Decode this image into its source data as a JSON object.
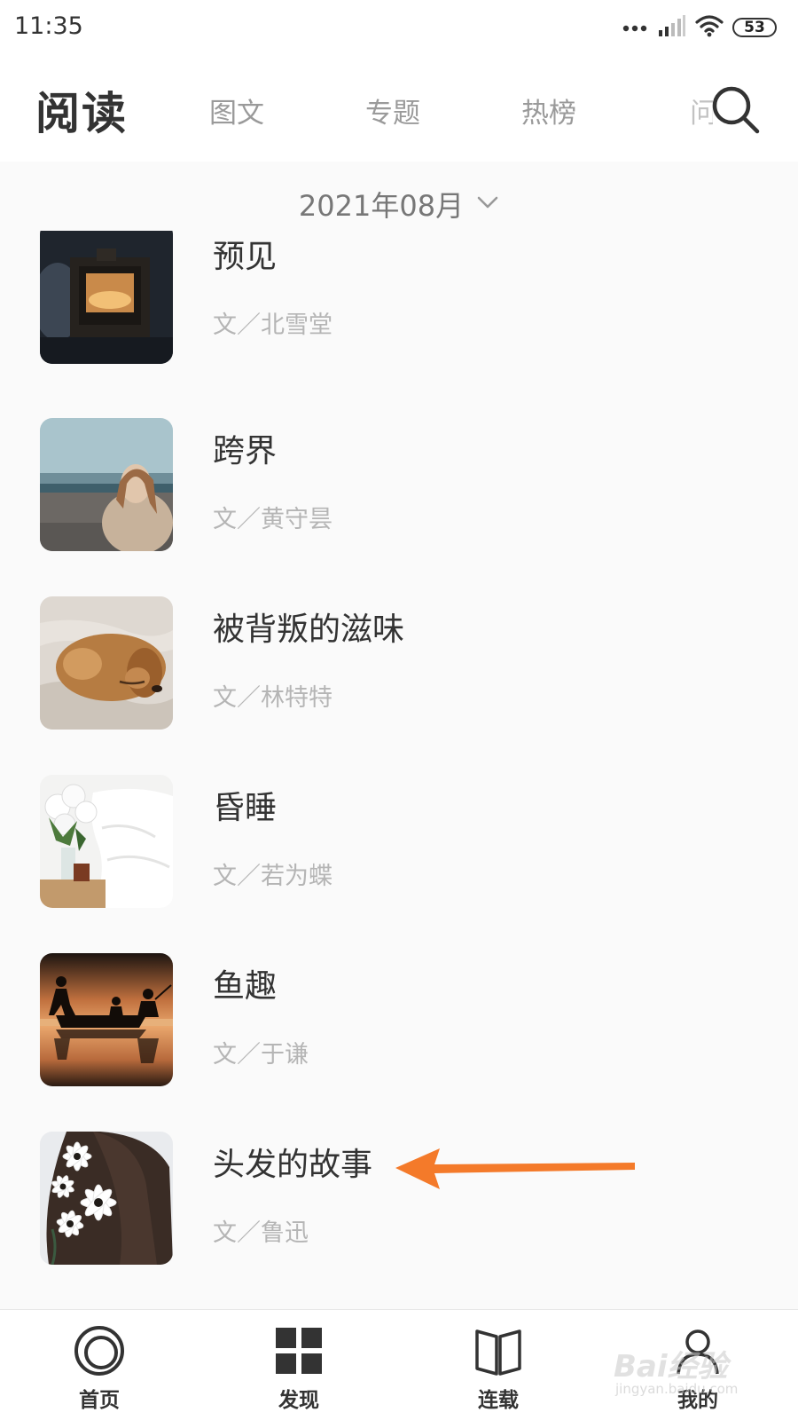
{
  "status_bar": {
    "time": "11:35",
    "battery": "53",
    "icons": [
      "signal-dots-icon",
      "cellular-signal-icon",
      "wifi-icon",
      "battery-icon"
    ]
  },
  "header": {
    "title": "阅读",
    "tabs": [
      {
        "label": "图文"
      },
      {
        "label": "专题"
      },
      {
        "label": "热榜"
      },
      {
        "label": "问"
      }
    ],
    "search_icon": "search-icon"
  },
  "month_selector": {
    "label": "2021年08月",
    "icon": "chevron-down-icon"
  },
  "articles": [
    {
      "title": "预见",
      "author": "文／北雪堂"
    },
    {
      "title": "跨界",
      "author": "文／黄守昙"
    },
    {
      "title": "被背叛的滋味",
      "author": "文／林特特"
    },
    {
      "title": "昏睡",
      "author": "文／若为蝶"
    },
    {
      "title": "鱼趣",
      "author": "文／于谦"
    },
    {
      "title": "头发的故事",
      "author": "文／鲁迅"
    }
  ],
  "annotation": {
    "icon": "arrow-left-icon",
    "color": "#f47a2a"
  },
  "bottom_nav": [
    {
      "label": "首页",
      "icon": "home-ring-icon"
    },
    {
      "label": "发现",
      "icon": "grid-icon"
    },
    {
      "label": "连载",
      "icon": "book-icon"
    },
    {
      "label": "我的",
      "icon": "user-icon"
    }
  ],
  "watermark": {
    "text": "Bai经验",
    "subtext": "jingyan.baidu.com"
  },
  "colors": {
    "background": "#fafafa",
    "title_text": "#333333",
    "muted_text": "#b5b5b5",
    "tab_text": "#9a9a9a",
    "accent_arrow": "#f47a2a"
  }
}
